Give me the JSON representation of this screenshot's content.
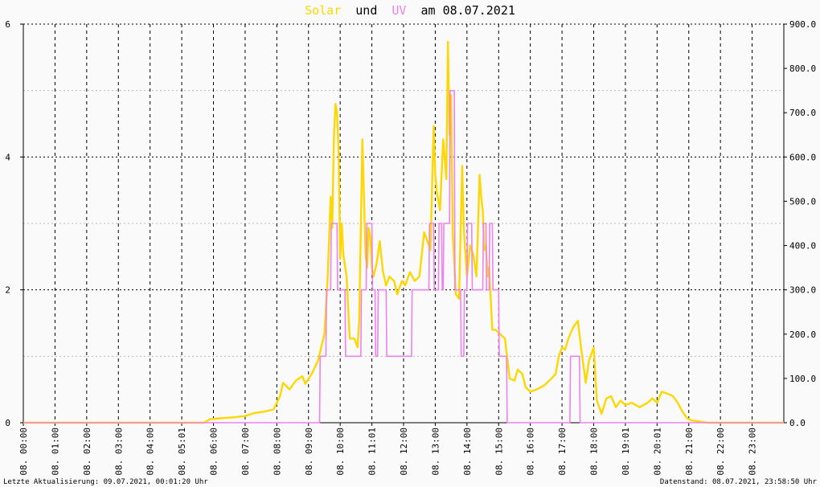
{
  "chart_data": {
    "type": "line",
    "title": {
      "part1": "Solar",
      "part2": "und",
      "part3": "UV",
      "part4": "am 08.07.2021"
    },
    "colors": {
      "solar": "#ffd700",
      "uv": "#ee82ee",
      "solar_title": "#ffd700",
      "uv_title": "#ee82ee"
    },
    "y_left": {
      "lim": [
        0,
        6
      ],
      "ticks": [
        "0",
        "2",
        "4",
        "6"
      ],
      "gridlines": [
        0,
        1,
        2,
        3,
        4,
        5,
        6
      ]
    },
    "y_right": {
      "lim": [
        0,
        900
      ],
      "ticks": [
        "0.0",
        "100.0",
        "200.0",
        "300.0",
        "400.0",
        "500.0",
        "600.0",
        "700.0",
        "800.0",
        "900.0"
      ]
    },
    "x_ticks": [
      "08. 00:00",
      "08. 01:00",
      "08. 02:00",
      "08. 03:00",
      "08. 04:00",
      "08. 05:01",
      "08. 06:00",
      "08. 07:00",
      "08. 08:00",
      "08. 09:00",
      "08. 10:00",
      "08. 11:01",
      "08. 12:00",
      "08. 13:00",
      "08. 14:00",
      "08. 15:00",
      "08. 16:00",
      "08. 17:00",
      "08. 18:00",
      "08. 19:01",
      "08. 20:01",
      "08. 21:00",
      "08. 22:00",
      "08. 23:00"
    ],
    "series": [
      {
        "name": "Solar",
        "axis": "right",
        "x": [
          0,
          5.7,
          5.9,
          6.2,
          6.6,
          7.0,
          7.3,
          7.6,
          7.9,
          8.1,
          8.2,
          8.4,
          8.6,
          8.8,
          8.9,
          9.1,
          9.3,
          9.5,
          9.6,
          9.7,
          9.75,
          9.8,
          9.85,
          9.9,
          9.95,
          10.0,
          10.05,
          10.1,
          10.2,
          10.3,
          10.45,
          10.55,
          10.6,
          10.7,
          10.8,
          10.85,
          10.9,
          10.95,
          11.0,
          11.05,
          11.15,
          11.25,
          11.35,
          11.45,
          11.55,
          11.7,
          11.8,
          11.95,
          12.05,
          12.2,
          12.35,
          12.5,
          12.65,
          12.75,
          12.85,
          12.95,
          13.0,
          13.05,
          13.15,
          13.25,
          13.35,
          13.4,
          13.45,
          13.5,
          13.55,
          13.65,
          13.75,
          13.85,
          13.9,
          14.0,
          14.1,
          14.2,
          14.3,
          14.4,
          14.45,
          14.5,
          14.55,
          14.6,
          14.65,
          14.7,
          14.8,
          14.9,
          15.05,
          15.2,
          15.35,
          15.5,
          15.6,
          15.75,
          15.85,
          16.0,
          16.2,
          16.45,
          16.6,
          16.8,
          16.9,
          17.0,
          17.1,
          17.2,
          17.35,
          17.5,
          17.6,
          17.75,
          17.85,
          18.0,
          18.1,
          18.25,
          18.4,
          18.55,
          18.7,
          18.85,
          19.0,
          19.2,
          19.45,
          19.7,
          19.85,
          20.0,
          20.15,
          20.35,
          20.5,
          20.65,
          20.8,
          20.95,
          21.1,
          21.3,
          21.6,
          22.0,
          24.0
        ],
        "values": [
          0,
          0,
          8,
          10,
          12,
          15,
          22,
          25,
          30,
          60,
          90,
          75,
          95,
          105,
          88,
          110,
          140,
          200,
          320,
          510,
          440,
          640,
          720,
          700,
          610,
          370,
          450,
          380,
          330,
          190,
          190,
          170,
          230,
          640,
          380,
          350,
          440,
          420,
          350,
          330,
          360,
          410,
          340,
          310,
          330,
          320,
          290,
          320,
          310,
          340,
          320,
          330,
          430,
          410,
          390,
          670,
          560,
          520,
          480,
          640,
          550,
          860,
          650,
          740,
          430,
          290,
          280,
          580,
          440,
          330,
          400,
          380,
          330,
          560,
          510,
          480,
          390,
          400,
          330,
          350,
          210,
          210,
          200,
          190,
          100,
          95,
          120,
          110,
          80,
          70,
          75,
          85,
          95,
          110,
          150,
          170,
          165,
          190,
          215,
          230,
          170,
          90,
          140,
          170,
          50,
          20,
          55,
          60,
          35,
          50,
          40,
          45,
          35,
          45,
          55,
          45,
          70,
          65,
          60,
          45,
          25,
          10,
          5,
          3,
          0,
          0,
          0
        ]
      },
      {
        "name": "UV",
        "axis": "left",
        "x": [
          0,
          9.35,
          9.37,
          9.55,
          9.57,
          9.7,
          9.72,
          9.9,
          9.92,
          10.15,
          10.17,
          10.65,
          10.67,
          10.82,
          10.84,
          11.0,
          11.02,
          11.1,
          11.12,
          11.18,
          11.2,
          11.45,
          11.47,
          12.25,
          12.27,
          12.8,
          12.82,
          12.95,
          12.97,
          13.1,
          13.12,
          13.2,
          13.22,
          13.25,
          13.27,
          13.45,
          13.47,
          13.6,
          13.62,
          13.8,
          13.82,
          13.9,
          13.92,
          14.0,
          14.02,
          14.15,
          14.17,
          14.5,
          14.52,
          14.6,
          14.62,
          14.7,
          14.72,
          14.8,
          14.82,
          15.0,
          15.02,
          15.25,
          15.27,
          17.25,
          17.27,
          17.55,
          17.57,
          24.0
        ],
        "values": [
          0,
          0,
          1,
          1,
          2,
          2,
          3,
          3,
          2,
          2,
          1,
          1,
          2,
          2,
          3,
          3,
          2,
          2,
          1,
          1,
          2,
          2,
          1,
          1,
          2,
          2,
          3,
          3,
          2,
          2,
          3,
          3,
          2,
          2,
          3,
          3,
          5,
          5,
          2,
          2,
          1,
          1,
          2,
          2,
          3,
          3,
          2,
          2,
          3,
          3,
          2,
          2,
          3,
          3,
          2,
          2,
          1,
          1,
          0,
          0,
          1,
          1,
          0,
          0
        ]
      }
    ],
    "grid": true
  },
  "footer": {
    "left": "Letzte Aktualisierung: 09.07.2021, 00:01:20 Uhr",
    "right": "Datenstand: 08.07.2021, 23:58:50 Uhr"
  }
}
